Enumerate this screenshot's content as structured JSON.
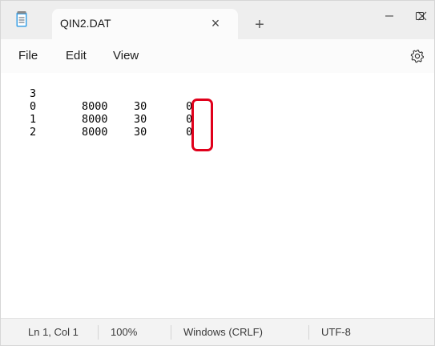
{
  "window": {
    "tab_title": "QIN2.DAT",
    "tab_close_symbol": "×",
    "new_tab_symbol": "+",
    "icons": [
      "notepad-icon",
      "close-tab-icon",
      "plus-icon",
      "minimize-icon",
      "maximize-icon",
      "close-icon",
      "gear-icon"
    ]
  },
  "menu": {
    "file": "File",
    "edit": "Edit",
    "view": "View"
  },
  "editor": {
    "content": "3\n0       8000    30      0\n1       8000    30      0\n2       8000    30      0",
    "highlight_color": "#e0001b"
  },
  "status": {
    "position": "Ln 1, Col 1",
    "zoom": "100%",
    "line_endings": "Windows (CRLF)",
    "encoding": "UTF-8"
  }
}
